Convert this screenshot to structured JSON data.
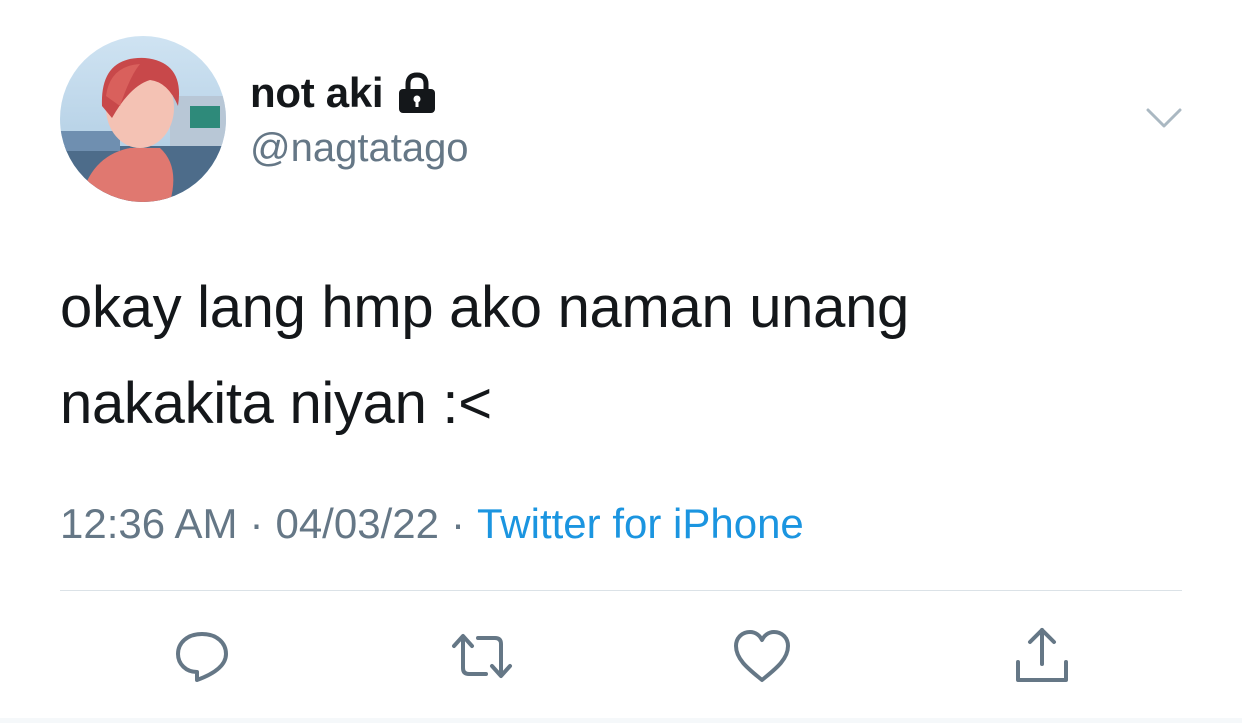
{
  "user": {
    "display_name": "not aki",
    "handle": "@nagtatago",
    "protected_icon": "lock-icon",
    "avatar": "avatar-photo"
  },
  "menu": {
    "icon": "chevron-down-icon"
  },
  "tweet": {
    "text_line1": "okay lang hmp ako naman unang",
    "text_line2": "nakakita niyan :<"
  },
  "meta": {
    "time": "12:36 AM",
    "separator": "·",
    "date": "04/03/22",
    "source": "Twitter for iPhone"
  },
  "actions": [
    {
      "icon": "reply-icon"
    },
    {
      "icon": "retweet-icon"
    },
    {
      "icon": "like-icon"
    },
    {
      "icon": "share-icon"
    }
  ],
  "colors": {
    "text": "#14171a",
    "secondary": "#657786",
    "link": "#1b95e0",
    "divider": "#dbe2e7"
  }
}
